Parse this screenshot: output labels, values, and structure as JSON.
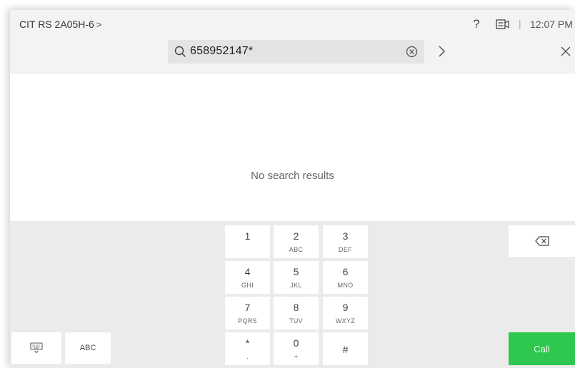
{
  "header": {
    "device_name": "CIT RS 2A05H-6",
    "device_chevron": ">",
    "help_symbol": "?",
    "separator": "|",
    "time": "12:07 PM",
    "icons": [
      "chevron-right-icon",
      "help-icon",
      "camera-settings-icon",
      "search-icon",
      "clear-icon",
      "chevron-right-icon",
      "close-icon",
      "keyboard-icon",
      "backspace-icon"
    ]
  },
  "search": {
    "query": "658952147*"
  },
  "results": {
    "empty_message": "No search results"
  },
  "keypad": {
    "keys": [
      {
        "digit": "1",
        "letters": ""
      },
      {
        "digit": "2",
        "letters": "ABC"
      },
      {
        "digit": "3",
        "letters": "DEF"
      },
      {
        "digit": "4",
        "letters": "GHI"
      },
      {
        "digit": "5",
        "letters": "JKL"
      },
      {
        "digit": "6",
        "letters": "MNO"
      },
      {
        "digit": "7",
        "letters": "PQRS"
      },
      {
        "digit": "8",
        "letters": "TUV"
      },
      {
        "digit": "9",
        "letters": "WXYZ"
      },
      {
        "digit": "*",
        "letters": "."
      },
      {
        "digit": "0",
        "letters": "+"
      },
      {
        "digit": "#",
        "letters": ""
      }
    ],
    "abc_label": "ABC",
    "call_label": "Call"
  },
  "colors": {
    "call_green": "#2dc84d",
    "topbar_bg": "#f3f3f3",
    "keypad_bg": "#ebebeb"
  }
}
